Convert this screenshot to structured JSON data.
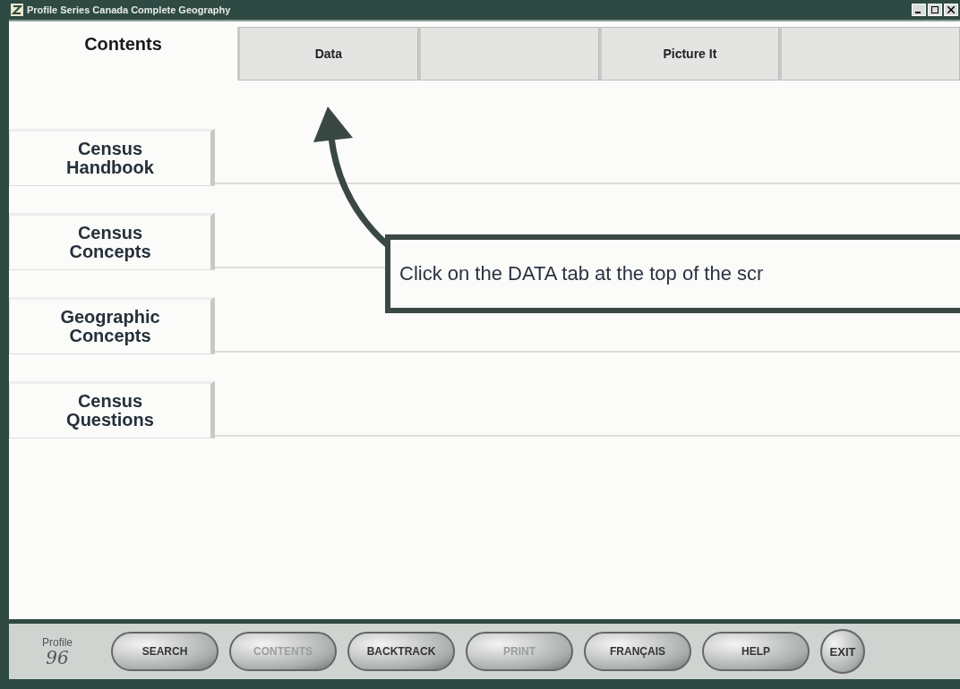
{
  "window": {
    "title": "Profile Series Canada Complete Geography"
  },
  "tabs": [
    {
      "label": "Contents",
      "selected": true
    },
    {
      "label": "Data",
      "selected": false
    },
    {
      "selected": false
    },
    {
      "label": "Picture It",
      "selected": false
    },
    {
      "selected": false
    }
  ],
  "side_tabs": [
    {
      "label": "Census Handbook"
    },
    {
      "label": "Census Concepts"
    },
    {
      "label": "Geographic Concepts"
    },
    {
      "label": "Census Questions"
    }
  ],
  "callout": {
    "text": "Click on the DATA tab at the top of the scr"
  },
  "toolbar": {
    "logo": {
      "name": "Profile",
      "number": "96"
    },
    "buttons": [
      {
        "label": "SEARCH",
        "disabled": false
      },
      {
        "label": "CONTENTS",
        "disabled": true
      },
      {
        "label": "BACKTRACK",
        "disabled": false
      },
      {
        "label": "PRINT",
        "disabled": true
      },
      {
        "label": "FRANÇAIS",
        "disabled": false
      },
      {
        "label": "HELP",
        "disabled": false
      },
      {
        "label": "EXIT",
        "disabled": false,
        "kind": "round"
      }
    ]
  }
}
